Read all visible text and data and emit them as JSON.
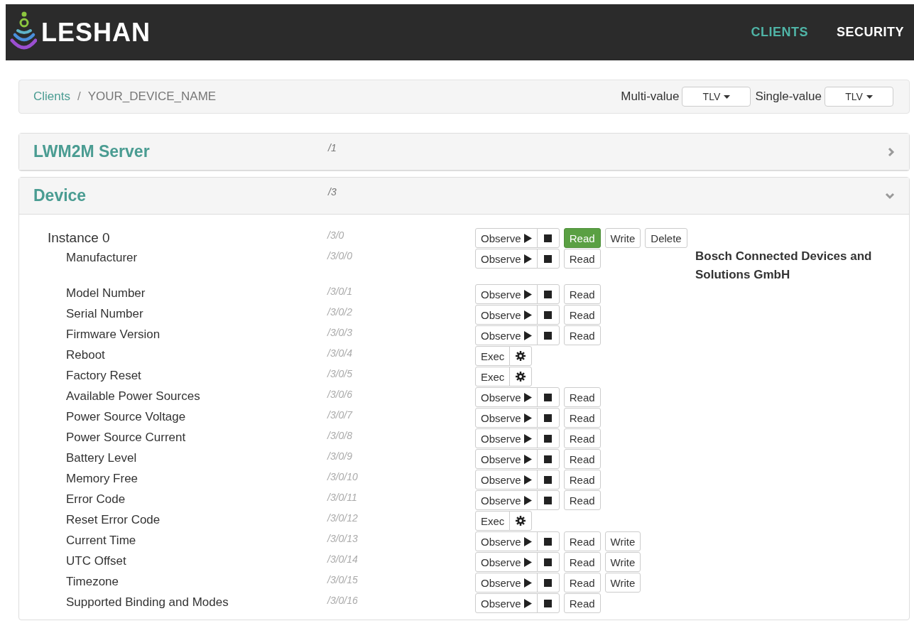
{
  "header": {
    "brand": "LESHAN",
    "nav": [
      {
        "label": "CLIENTS",
        "selected": true
      },
      {
        "label": "SECURITY",
        "selected": false
      }
    ]
  },
  "breadcrumb": {
    "items": [
      "Clients",
      "YOUR_DEVICE_NAME"
    ],
    "separator": "/"
  },
  "formats": [
    {
      "label": "Multi-value",
      "value": "TLV"
    },
    {
      "label": "Single-value",
      "value": "TLV"
    }
  ],
  "objects": [
    {
      "name": "LWM2M Server",
      "path": "/1",
      "expanded": false
    },
    {
      "name": "Device",
      "path": "/3",
      "expanded": true,
      "instances": [
        {
          "name": "Instance 0",
          "path": "/3/0",
          "actions": [
            {
              "kind": "observe",
              "label": "Observe"
            },
            {
              "kind": "stop"
            },
            {
              "kind": "read",
              "label": "Read",
              "selected": true
            },
            {
              "kind": "write",
              "label": "Write"
            },
            {
              "kind": "delete",
              "label": "Delete"
            }
          ],
          "resources": [
            {
              "name": "Manufacturer",
              "path": "/3/0/0",
              "actions": [
                {
                  "kind": "observe",
                  "label": "Observe"
                },
                {
                  "kind": "stop"
                },
                {
                  "kind": "read",
                  "label": "Read",
                  "selected": false
                }
              ],
              "value": "Bosch Connected Devices and Solutions GmbH"
            },
            {
              "name": "Model Number",
              "path": "/3/0/1",
              "actions": [
                {
                  "kind": "observe",
                  "label": "Observe"
                },
                {
                  "kind": "stop"
                },
                {
                  "kind": "read",
                  "label": "Read",
                  "selected": false
                }
              ]
            },
            {
              "name": "Serial Number",
              "path": "/3/0/2",
              "actions": [
                {
                  "kind": "observe",
                  "label": "Observe"
                },
                {
                  "kind": "stop"
                },
                {
                  "kind": "read",
                  "label": "Read",
                  "selected": false
                }
              ]
            },
            {
              "name": "Firmware Version",
              "path": "/3/0/3",
              "actions": [
                {
                  "kind": "observe",
                  "label": "Observe"
                },
                {
                  "kind": "stop"
                },
                {
                  "kind": "read",
                  "label": "Read",
                  "selected": false
                }
              ]
            },
            {
              "name": "Reboot",
              "path": "/3/0/4",
              "actions": [
                {
                  "kind": "exec",
                  "label": "Exec"
                },
                {
                  "kind": "settings"
                }
              ]
            },
            {
              "name": "Factory Reset",
              "path": "/3/0/5",
              "actions": [
                {
                  "kind": "exec",
                  "label": "Exec"
                },
                {
                  "kind": "settings"
                }
              ]
            },
            {
              "name": "Available Power Sources",
              "path": "/3/0/6",
              "actions": [
                {
                  "kind": "observe",
                  "label": "Observe"
                },
                {
                  "kind": "stop"
                },
                {
                  "kind": "read",
                  "label": "Read",
                  "selected": false
                }
              ]
            },
            {
              "name": "Power Source Voltage",
              "path": "/3/0/7",
              "actions": [
                {
                  "kind": "observe",
                  "label": "Observe"
                },
                {
                  "kind": "stop"
                },
                {
                  "kind": "read",
                  "label": "Read",
                  "selected": false
                }
              ]
            },
            {
              "name": "Power Source Current",
              "path": "/3/0/8",
              "actions": [
                {
                  "kind": "observe",
                  "label": "Observe"
                },
                {
                  "kind": "stop"
                },
                {
                  "kind": "read",
                  "label": "Read",
                  "selected": false
                }
              ]
            },
            {
              "name": "Battery Level",
              "path": "/3/0/9",
              "actions": [
                {
                  "kind": "observe",
                  "label": "Observe"
                },
                {
                  "kind": "stop"
                },
                {
                  "kind": "read",
                  "label": "Read",
                  "selected": false
                }
              ]
            },
            {
              "name": "Memory Free",
              "path": "/3/0/10",
              "actions": [
                {
                  "kind": "observe",
                  "label": "Observe"
                },
                {
                  "kind": "stop"
                },
                {
                  "kind": "read",
                  "label": "Read",
                  "selected": false
                }
              ]
            },
            {
              "name": "Error Code",
              "path": "/3/0/11",
              "actions": [
                {
                  "kind": "observe",
                  "label": "Observe"
                },
                {
                  "kind": "stop"
                },
                {
                  "kind": "read",
                  "label": "Read",
                  "selected": false
                }
              ]
            },
            {
              "name": "Reset Error Code",
              "path": "/3/0/12",
              "actions": [
                {
                  "kind": "exec",
                  "label": "Exec"
                },
                {
                  "kind": "settings"
                }
              ]
            },
            {
              "name": "Current Time",
              "path": "/3/0/13",
              "actions": [
                {
                  "kind": "observe",
                  "label": "Observe"
                },
                {
                  "kind": "stop"
                },
                {
                  "kind": "read",
                  "label": "Read",
                  "selected": false
                },
                {
                  "kind": "write",
                  "label": "Write"
                }
              ]
            },
            {
              "name": "UTC Offset",
              "path": "/3/0/14",
              "actions": [
                {
                  "kind": "observe",
                  "label": "Observe"
                },
                {
                  "kind": "stop"
                },
                {
                  "kind": "read",
                  "label": "Read",
                  "selected": false
                },
                {
                  "kind": "write",
                  "label": "Write"
                }
              ]
            },
            {
              "name": "Timezone",
              "path": "/3/0/15",
              "actions": [
                {
                  "kind": "observe",
                  "label": "Observe"
                },
                {
                  "kind": "stop"
                },
                {
                  "kind": "read",
                  "label": "Read",
                  "selected": false
                },
                {
                  "kind": "write",
                  "label": "Write"
                }
              ]
            },
            {
              "name": "Supported Binding and Modes",
              "path": "/3/0/16",
              "actions": [
                {
                  "kind": "observe",
                  "label": "Observe"
                },
                {
                  "kind": "stop"
                },
                {
                  "kind": "read",
                  "label": "Read",
                  "selected": false
                }
              ]
            }
          ]
        }
      ]
    }
  ]
}
